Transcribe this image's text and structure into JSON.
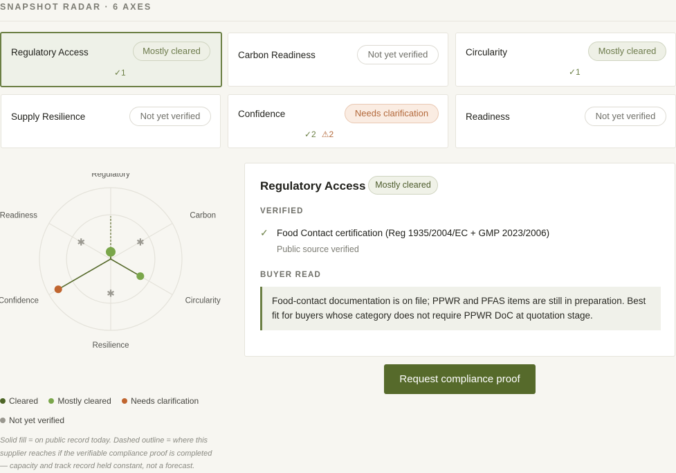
{
  "section_title": "SNAPSHOT RADAR · 6 AXES",
  "cards": [
    {
      "label": "Regulatory Access",
      "status": "Mostly cleared",
      "verified_count": "✓1",
      "flag_count": ""
    },
    {
      "label": "Carbon Readiness",
      "status": "Not yet verified",
      "verified_count": "",
      "flag_count": ""
    },
    {
      "label": "Circularity",
      "status": "Mostly cleared",
      "verified_count": "✓1",
      "flag_count": ""
    },
    {
      "label": "Supply Resilience",
      "status": "Not yet verified",
      "verified_count": "",
      "flag_count": ""
    },
    {
      "label": "Confidence",
      "status": "Needs clarification",
      "verified_count": "✓2",
      "flag_count": "⚠2"
    },
    {
      "label": "Readiness",
      "status": "Not yet verified",
      "verified_count": "",
      "flag_count": ""
    }
  ],
  "radar": {
    "axes": [
      {
        "label": "Regulatory",
        "status": "Mostly cleared",
        "value": 0.1,
        "potential": 0.6
      },
      {
        "label": "Carbon",
        "status": "Not yet verified",
        "value": 0.48
      },
      {
        "label": "Circularity",
        "status": "Mostly cleared",
        "value": 0.48
      },
      {
        "label": "Resilience",
        "status": "Not yet verified",
        "value": 0.48
      },
      {
        "label": "Confidence",
        "status": "Needs clarification",
        "value": 0.85
      },
      {
        "label": "Readiness",
        "status": "Not yet verified",
        "value": 0.48
      }
    ]
  },
  "detail": {
    "title": "Regulatory Access",
    "status": "Mostly cleared",
    "verified_heading": "VERIFIED",
    "verified_item": "Food Contact certification (Reg 1935/2004/EC + GMP 2023/2006)",
    "verified_source": "Public source verified",
    "buyer_heading": "BUYER READ",
    "buyer_text": "Food-contact documentation is on file; PPWR and PFAS items are still in preparation. Best fit for buyers whose category does not require PPWR DoC at quotation stage."
  },
  "cta_label": "Request compliance proof",
  "legend": [
    {
      "label": "Cleared",
      "color": "#4d6526"
    },
    {
      "label": "Mostly cleared",
      "color": "#7aa64a"
    },
    {
      "label": "Needs clarification",
      "color": "#c0652f"
    },
    {
      "label": "Not yet verified",
      "color": "#9a9890"
    }
  ],
  "note": "Solid fill = on public record today. Dashed outline = where this supplier reaches if the verifiable compliance proof is completed — capacity and track record held constant, not a forecast.",
  "colors": {
    "accent": "#566a2b",
    "mostly": "#7aa64a",
    "needs": "#c0652f",
    "unverified": "#9a9890"
  }
}
